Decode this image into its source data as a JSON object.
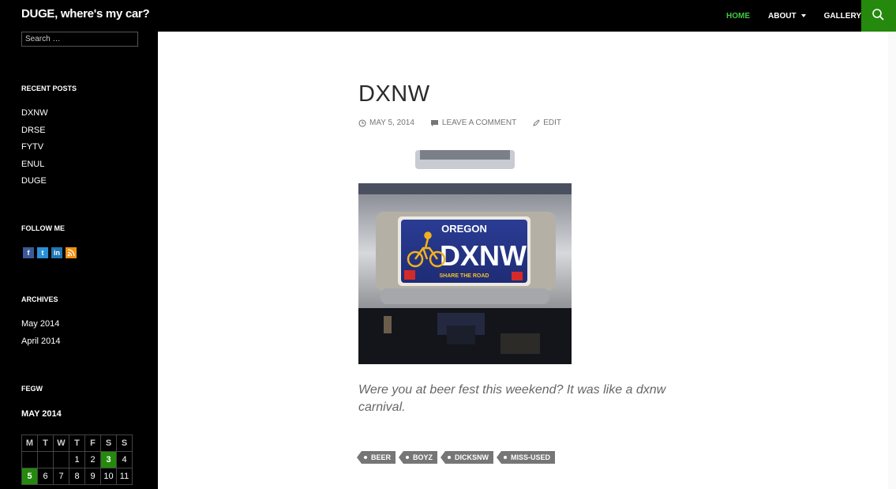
{
  "header": {
    "site_title": "DUGE, where's my car?",
    "nav": [
      "HOME",
      "ABOUT",
      "GALLERY"
    ],
    "accent": "#41c942",
    "search_bg": "#24890d"
  },
  "sidebar": {
    "search_placeholder": "Search …",
    "recent_title": "RECENT POSTS",
    "recent_posts": [
      "DXNW",
      "DRSE",
      "FYTV",
      "ENUL",
      "DUGE"
    ],
    "follow_title": "FOLLOW ME",
    "social_icons": [
      "facebook-icon",
      "twitter-icon",
      "linkedin-icon",
      "rss-icon"
    ],
    "archives_title": "ARCHIVES",
    "archives": [
      "May 2014",
      "April 2014"
    ],
    "calendar_widget_title": "FEGW",
    "calendar": {
      "month": "MAY 2014",
      "weekdays": [
        "M",
        "T",
        "W",
        "T",
        "F",
        "S",
        "S"
      ],
      "rows": [
        [
          "",
          "",
          "",
          "1",
          "2",
          "3",
          "4"
        ],
        [
          "5",
          "6",
          "7",
          "8",
          "9",
          "10",
          "11"
        ]
      ],
      "highlighted": [
        "3",
        "5"
      ]
    }
  },
  "post": {
    "title": "DXNW",
    "date": "MAY 5, 2014",
    "comment_link": "LEAVE A COMMENT",
    "edit_link": "EDIT",
    "plate_state": "OREGON",
    "plate_number": "DXNW",
    "plate_slogan": "SHARE THE ROAD",
    "excerpt": "Were you at beer fest this weekend?  It was like a dxnw carnival.",
    "tags": [
      "BEER",
      "BOYZ",
      "DICKSNW",
      "MISS-USED"
    ]
  }
}
